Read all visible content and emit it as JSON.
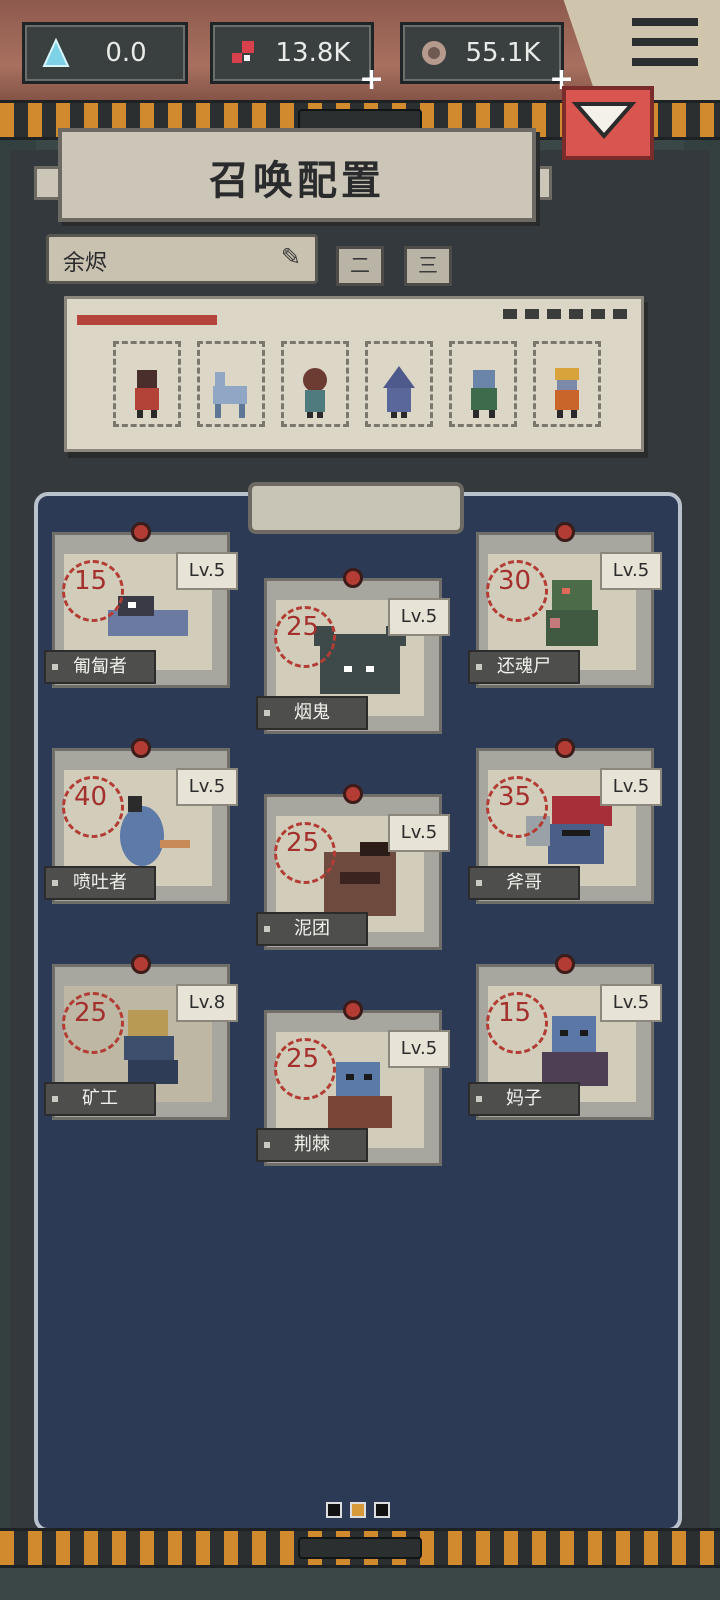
{
  "resources": [
    {
      "value": "0.0",
      "icon": "crystal-icon",
      "color": "#7fd2e6"
    },
    {
      "value": "13.8K",
      "icon": "blood-icon",
      "color": "#d8414c",
      "plus": "+"
    },
    {
      "value": "55.1K",
      "icon": "bone-icon",
      "color": "#b69a8d",
      "plus": "+"
    }
  ],
  "title": "召唤配置",
  "preset": {
    "name": "余烬"
  },
  "slots": [
    "二",
    "三"
  ],
  "team_icons": [
    "imp",
    "wolf",
    "thorn",
    "hood",
    "ghoul",
    "miner"
  ],
  "roster": [
    {
      "cost": "15",
      "lv": "Lv.5",
      "name": "匍匐者"
    },
    {
      "cost": "25",
      "lv": "Lv.5",
      "name": "烟鬼"
    },
    {
      "cost": "30",
      "lv": "Lv.5",
      "name": "还魂尸"
    },
    {
      "cost": "40",
      "lv": "Lv.5",
      "name": "喷吐者"
    },
    {
      "cost": "25",
      "lv": "Lv.5",
      "name": "泥团"
    },
    {
      "cost": "35",
      "lv": "Lv.5",
      "name": "斧哥"
    },
    {
      "cost": "25",
      "lv": "Lv.8",
      "name": "矿工"
    },
    {
      "cost": "25",
      "lv": "Lv.5",
      "name": "荆棘"
    },
    {
      "cost": "15",
      "lv": "Lv.5",
      "name": "妈子"
    }
  ],
  "pager": {
    "pages": 3,
    "active": 2
  }
}
